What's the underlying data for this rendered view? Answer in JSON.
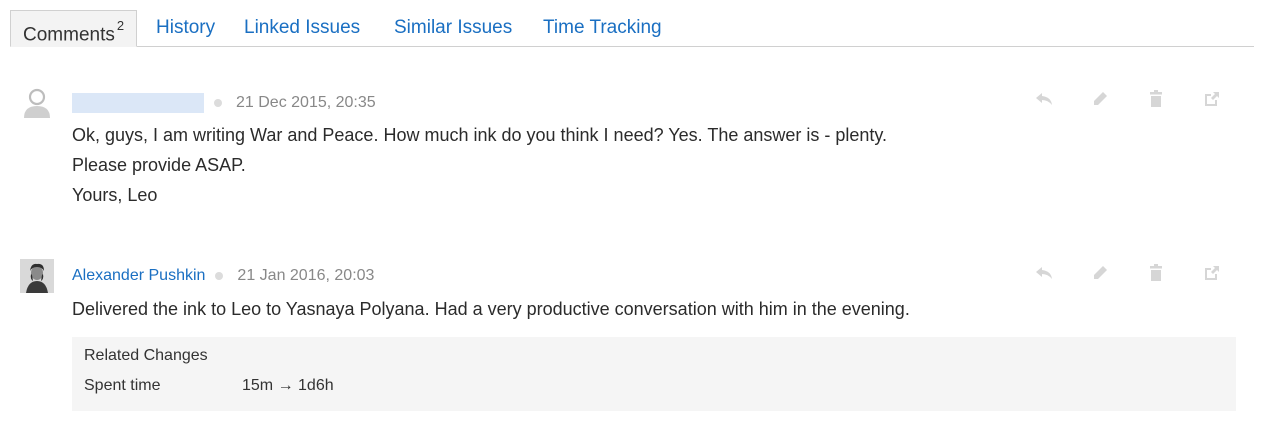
{
  "tabs": [
    {
      "label": "Comments",
      "count": "2"
    },
    {
      "label": "History"
    },
    {
      "label": "Linked Issues"
    },
    {
      "label": "Similar Issues"
    },
    {
      "label": "Time Tracking"
    }
  ],
  "comments": [
    {
      "timestamp": "21 Dec 2015, 20:35",
      "lines": [
        "Ok, guys, I am writing War and Peace. How much ink do you think I need? Yes. The answer is - plenty.",
        "Please provide ASAP.",
        "Yours, Leo"
      ]
    },
    {
      "author": "Alexander Pushkin",
      "timestamp": "21 Jan 2016, 20:03",
      "lines": [
        "Delivered the ink to Leo to Yasnaya Polyana. Had a very productive conversation with him in the evening."
      ],
      "related_changes": {
        "title": "Related Changes",
        "field": "Spent time",
        "value": "15m → 1d6h"
      }
    }
  ],
  "action_icons": [
    "reply-icon",
    "edit-icon",
    "delete-icon",
    "permalink-icon"
  ],
  "colors": {
    "link": "#1a6fc2",
    "icon": "#d6d6d6",
    "panel": "#f5f5f5"
  }
}
